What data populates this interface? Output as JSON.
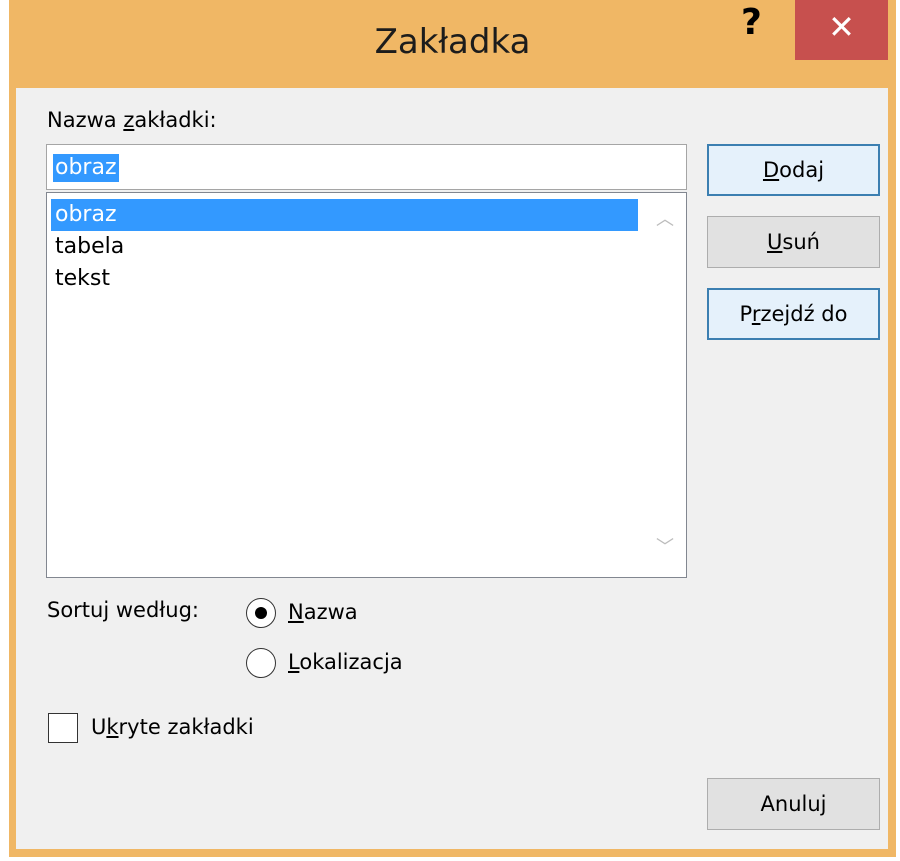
{
  "window": {
    "title": "Zakładka",
    "help_glyph": "?",
    "close_glyph": "✕"
  },
  "bookmark_name": {
    "label_pre": "Nazwa ",
    "label_key": "z",
    "label_post": "akładki:",
    "value": "obraz"
  },
  "bookmarks": [
    "obraz",
    "tabela",
    "tekst"
  ],
  "selected_bookmark": "obraz",
  "scroll": {
    "up_glyph": "︿",
    "down_glyph": "﹀"
  },
  "buttons": {
    "add": {
      "key": "D",
      "rest": "odaj"
    },
    "delete": {
      "key": "U",
      "rest": "suń"
    },
    "goto": {
      "pre": "P",
      "key": "r",
      "rest": "zejdź do"
    },
    "cancel": "Anuluj"
  },
  "sort": {
    "label": "Sortuj według:",
    "options": [
      {
        "key": "N",
        "rest": "azwa",
        "checked": true
      },
      {
        "key": "L",
        "rest": "okalizacja",
        "checked": false
      }
    ]
  },
  "hidden": {
    "pre": "U",
    "key": "k",
    "rest": "ryte zakładki",
    "checked": false
  },
  "colors": {
    "title_bar": "#f0b765",
    "close_button": "#c7504e",
    "selection": "#3399ff"
  }
}
